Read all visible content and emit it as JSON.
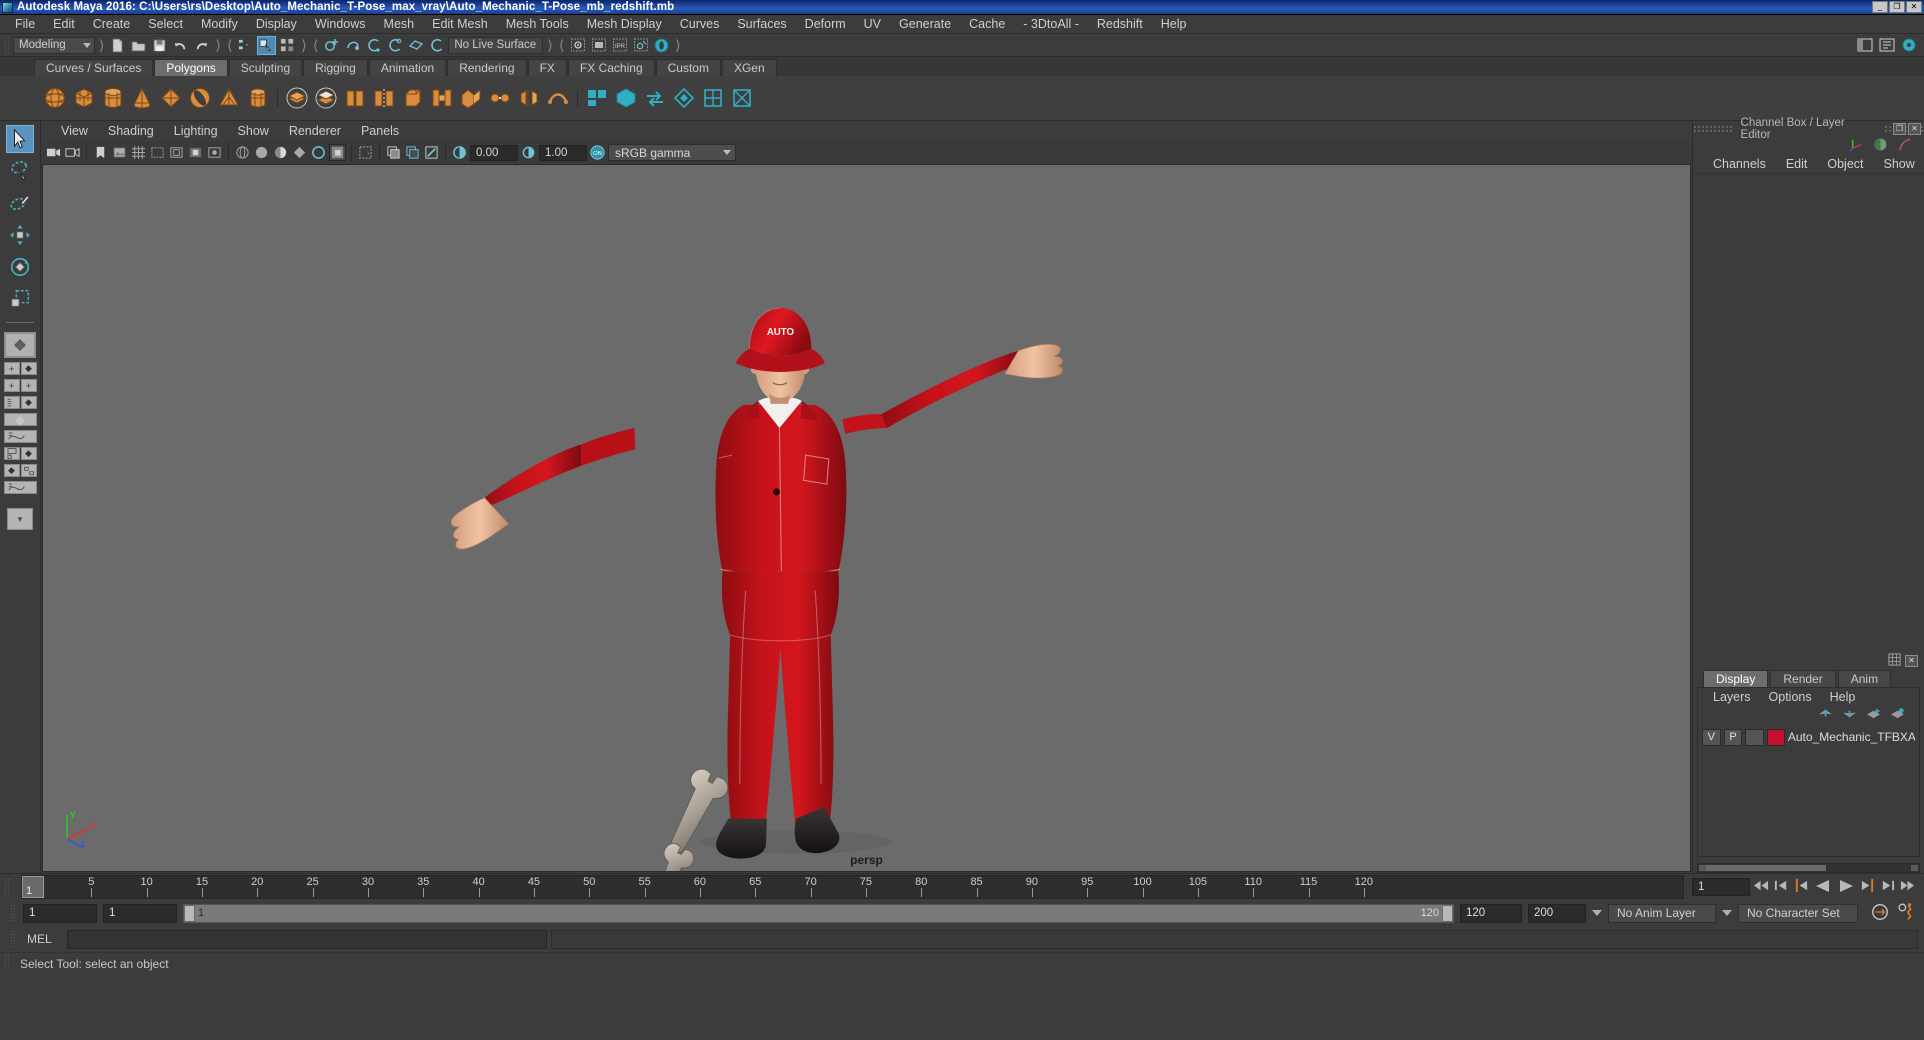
{
  "window": {
    "title": "Autodesk Maya 2016: C:\\Users\\rs\\Desktop\\Auto_Mechanic_T-Pose_max_vray\\Auto_Mechanic_T-Pose_mb_redshift.mb",
    "minimize": "_",
    "maximize": "❐",
    "close": "✕"
  },
  "menu": {
    "items": [
      {
        "label": "File"
      },
      {
        "label": "Edit"
      },
      {
        "label": "Create"
      },
      {
        "label": "Select"
      },
      {
        "label": "Modify"
      },
      {
        "label": "Display"
      },
      {
        "label": "Windows"
      },
      {
        "label": "Mesh"
      },
      {
        "label": "Edit Mesh"
      },
      {
        "label": "Mesh Tools"
      },
      {
        "label": "Mesh Display"
      },
      {
        "label": "Curves"
      },
      {
        "label": "Surfaces"
      },
      {
        "label": "Deform"
      },
      {
        "label": "UV"
      },
      {
        "label": "Generate"
      },
      {
        "label": "Cache"
      },
      {
        "label": "- 3DtoAll -"
      },
      {
        "label": "Redshift"
      },
      {
        "label": "Help"
      }
    ]
  },
  "toolbar": {
    "menuset": "Modeling",
    "live_surface": "No Live Surface"
  },
  "shelf": {
    "tabs": [
      {
        "label": "Curves / Surfaces",
        "active": false
      },
      {
        "label": "Polygons",
        "active": true
      },
      {
        "label": "Sculpting",
        "active": false
      },
      {
        "label": "Rigging",
        "active": false
      },
      {
        "label": "Animation",
        "active": false
      },
      {
        "label": "Rendering",
        "active": false
      },
      {
        "label": "FX",
        "active": false
      },
      {
        "label": "FX Caching",
        "active": false
      },
      {
        "label": "Custom",
        "active": false
      },
      {
        "label": "XGen",
        "active": false
      }
    ]
  },
  "viewport": {
    "menu": [
      {
        "label": "View"
      },
      {
        "label": "Shading"
      },
      {
        "label": "Lighting"
      },
      {
        "label": "Show"
      },
      {
        "label": "Renderer"
      },
      {
        "label": "Panels"
      }
    ],
    "exposure": "0.00",
    "gamma_value": "1.00",
    "color_management": "sRGB gamma",
    "cm_toggle": "ON",
    "camera_label": "persp",
    "axis": {
      "x": "x",
      "y": "y",
      "z": "z"
    },
    "bg_color": "#6b6b6b"
  },
  "right_panel": {
    "title": "Channel Box / Layer Editor",
    "menu": [
      {
        "label": "Channels"
      },
      {
        "label": "Edit"
      },
      {
        "label": "Object"
      },
      {
        "label": "Show"
      }
    ],
    "tabs": [
      {
        "label": "Display",
        "active": true
      },
      {
        "label": "Render",
        "active": false
      },
      {
        "label": "Anim",
        "active": false
      }
    ],
    "layer_menu": [
      {
        "label": "Layers"
      },
      {
        "label": "Options"
      },
      {
        "label": "Help"
      }
    ],
    "layers": [
      {
        "visible": "V",
        "playback": "P",
        "color": "#c2102e",
        "name": "Auto_Mechanic_TFBXASC"
      }
    ]
  },
  "timeline": {
    "ticks": [
      5,
      10,
      15,
      20,
      25,
      30,
      35,
      40,
      45,
      50,
      55,
      60,
      65,
      70,
      75,
      80,
      85,
      90,
      95,
      100,
      105,
      110,
      115,
      120
    ],
    "current_frame": "1",
    "current_frame_field": "1",
    "playback_buttons": [
      {
        "name": "go-to-start"
      },
      {
        "name": "step-back-key"
      },
      {
        "name": "step-back-frame"
      },
      {
        "name": "play-backwards"
      },
      {
        "name": "play-forwards"
      },
      {
        "name": "step-forward-frame"
      },
      {
        "name": "step-forward-key"
      },
      {
        "name": "go-to-end"
      }
    ]
  },
  "range": {
    "anim_start": "1",
    "range_start": "1",
    "bar_start": "1",
    "bar_end": "120",
    "range_end": "120",
    "anim_end": "200",
    "anim_layer": "No Anim Layer",
    "character_set": "No Character Set"
  },
  "command": {
    "language": "MEL",
    "input_value": "",
    "output_value": ""
  },
  "status": {
    "message": "Select Tool: select an object"
  }
}
